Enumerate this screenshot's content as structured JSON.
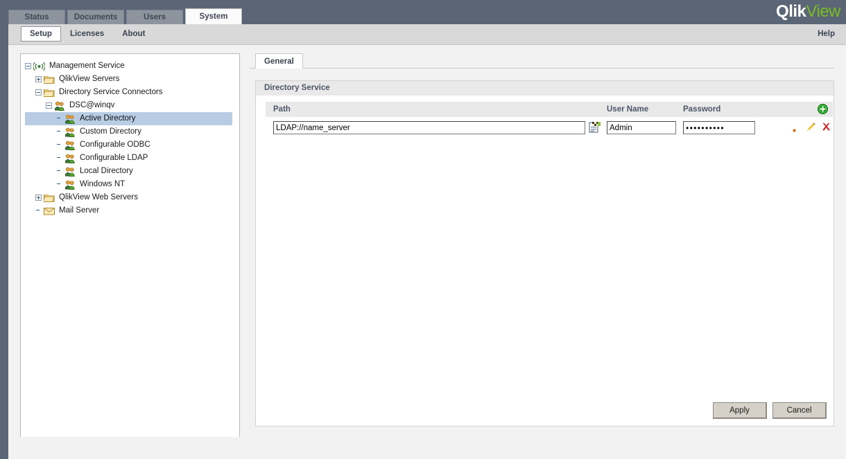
{
  "app": {
    "logo_primary": "Qlik",
    "logo_secondary": "View",
    "brand_green": "#78be20",
    "header_bg": "#5a6676"
  },
  "main_tabs": [
    {
      "label": "Status",
      "active": false
    },
    {
      "label": "Documents",
      "active": false
    },
    {
      "label": "Users",
      "active": false
    },
    {
      "label": "System",
      "active": true
    }
  ],
  "sub_tabs": [
    {
      "label": "Setup",
      "active": true
    },
    {
      "label": "Licenses",
      "active": false
    },
    {
      "label": "About",
      "active": false
    }
  ],
  "help_label": "Help",
  "tree": {
    "nodes": [
      {
        "label": "Management Service",
        "indent": 0,
        "expander": "minus",
        "icon": "broadcast-icon",
        "selected": false
      },
      {
        "label": "QlikView Servers",
        "indent": 1,
        "expander": "plus",
        "icon": "folder-icon",
        "selected": false
      },
      {
        "label": "Directory Service Connectors",
        "indent": 1,
        "expander": "minus",
        "icon": "folder-icon",
        "selected": false
      },
      {
        "label": "DSC@winqv",
        "indent": 2,
        "expander": "minus",
        "icon": "users-icon",
        "selected": false
      },
      {
        "label": "Active Directory",
        "indent": 3,
        "expander": "none",
        "icon": "users-icon",
        "selected": true
      },
      {
        "label": "Custom Directory",
        "indent": 3,
        "expander": "none",
        "icon": "users-icon",
        "selected": false
      },
      {
        "label": "Configurable ODBC",
        "indent": 3,
        "expander": "none",
        "icon": "users-icon",
        "selected": false
      },
      {
        "label": "Configurable LDAP",
        "indent": 3,
        "expander": "none",
        "icon": "users-icon",
        "selected": false
      },
      {
        "label": "Local Directory",
        "indent": 3,
        "expander": "none",
        "icon": "users-icon",
        "selected": false
      },
      {
        "label": "Windows NT",
        "indent": 3,
        "expander": "none",
        "icon": "users-icon",
        "selected": false
      },
      {
        "label": "QlikView Web Servers",
        "indent": 1,
        "expander": "plus",
        "icon": "folder-icon",
        "selected": false
      },
      {
        "label": "Mail Server",
        "indent": 1,
        "expander": "none",
        "icon": "envelope-icon",
        "selected": false
      }
    ],
    "selection_color": "#b8cce4"
  },
  "content": {
    "tab_label": "General",
    "section_title": "Directory Service",
    "grid": {
      "columns": {
        "path": "Path",
        "user_name": "User Name",
        "password": "Password"
      },
      "add_icon": "add-circle-icon",
      "rows": [
        {
          "path": "LDAP://name_server",
          "path_placeholder": "LDAP://name_server",
          "user_name": "Admin",
          "user_name_placeholder": "User Name",
          "password": "••••••••••",
          "browse_icon": "browse-folder-icon",
          "edit_icon": "pencil-icon",
          "delete_icon": "delete-x-icon",
          "status_icon": "required-asterisk-icon"
        }
      ]
    },
    "buttons": {
      "apply": "Apply",
      "cancel": "Cancel"
    }
  }
}
